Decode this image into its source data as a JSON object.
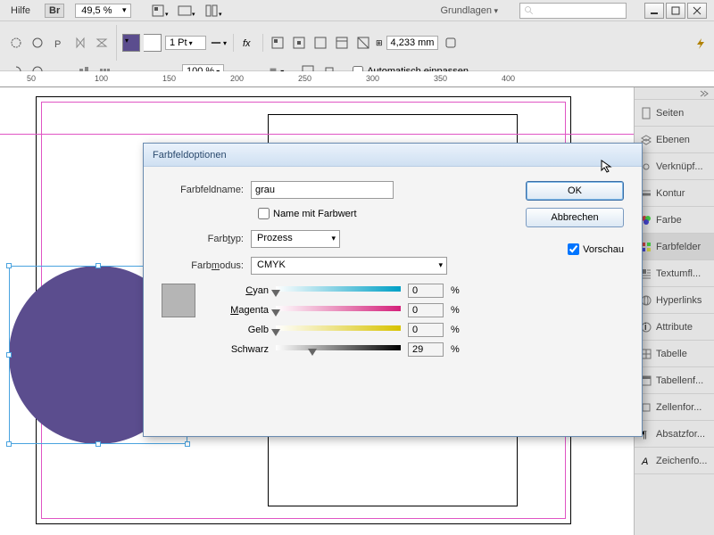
{
  "menubar": {
    "help": "Hilfe",
    "bridge": "Br",
    "zoom": "49,5 %",
    "workspace": "Grundlagen"
  },
  "controlbar": {
    "stroke_weight": "1 Pt",
    "opacity": "100 %",
    "w_field": "4,233 mm",
    "autofit": "Automatisch einpassen"
  },
  "ruler": {
    "ticks": [
      "50",
      "100",
      "150",
      "200",
      "250",
      "300",
      "350",
      "400"
    ]
  },
  "panels": {
    "items": [
      {
        "label": "Seiten"
      },
      {
        "label": "Ebenen"
      },
      {
        "label": "Verknüpf..."
      },
      {
        "label": "Kontur"
      },
      {
        "label": "Farbe"
      },
      {
        "label": "Farbfelder"
      },
      {
        "label": "Textumfl..."
      },
      {
        "label": "Hyperlinks"
      },
      {
        "label": "Attribute"
      },
      {
        "label": "Tabelle"
      },
      {
        "label": "Tabellenf..."
      },
      {
        "label": "Zellenfor..."
      },
      {
        "label": "Absatzfor..."
      },
      {
        "label": "Zeichenfo..."
      }
    ],
    "active_index": 5
  },
  "dialog": {
    "title": "Farbfeldoptionen",
    "name_label": "Farbfeldname:",
    "name_value": "grau",
    "name_with_value": "Name mit Farbwert",
    "type_label": "Farbtyp:",
    "type_value": "Prozess",
    "mode_label": "Farbmodus:",
    "mode_value": "CMYK",
    "ok": "OK",
    "cancel": "Abbrechen",
    "preview": "Vorschau",
    "sliders": {
      "cyan": {
        "label": "Cyan",
        "value": "0",
        "pct": "%",
        "pos": 0,
        "grad": "linear-gradient(to right,#fff,#00a0c6)"
      },
      "magenta": {
        "label": "Magenta",
        "value": "0",
        "pct": "%",
        "pos": 0,
        "grad": "linear-gradient(to right,#fff,#d4207a)"
      },
      "yellow": {
        "label": "Gelb",
        "value": "0",
        "pct": "%",
        "pos": 0,
        "grad": "linear-gradient(to right,#fff,#d8c300)"
      },
      "black": {
        "label": "Schwarz",
        "value": "29",
        "pct": "%",
        "pos": 29,
        "grad": "linear-gradient(to right,#fff,#000)"
      }
    }
  }
}
